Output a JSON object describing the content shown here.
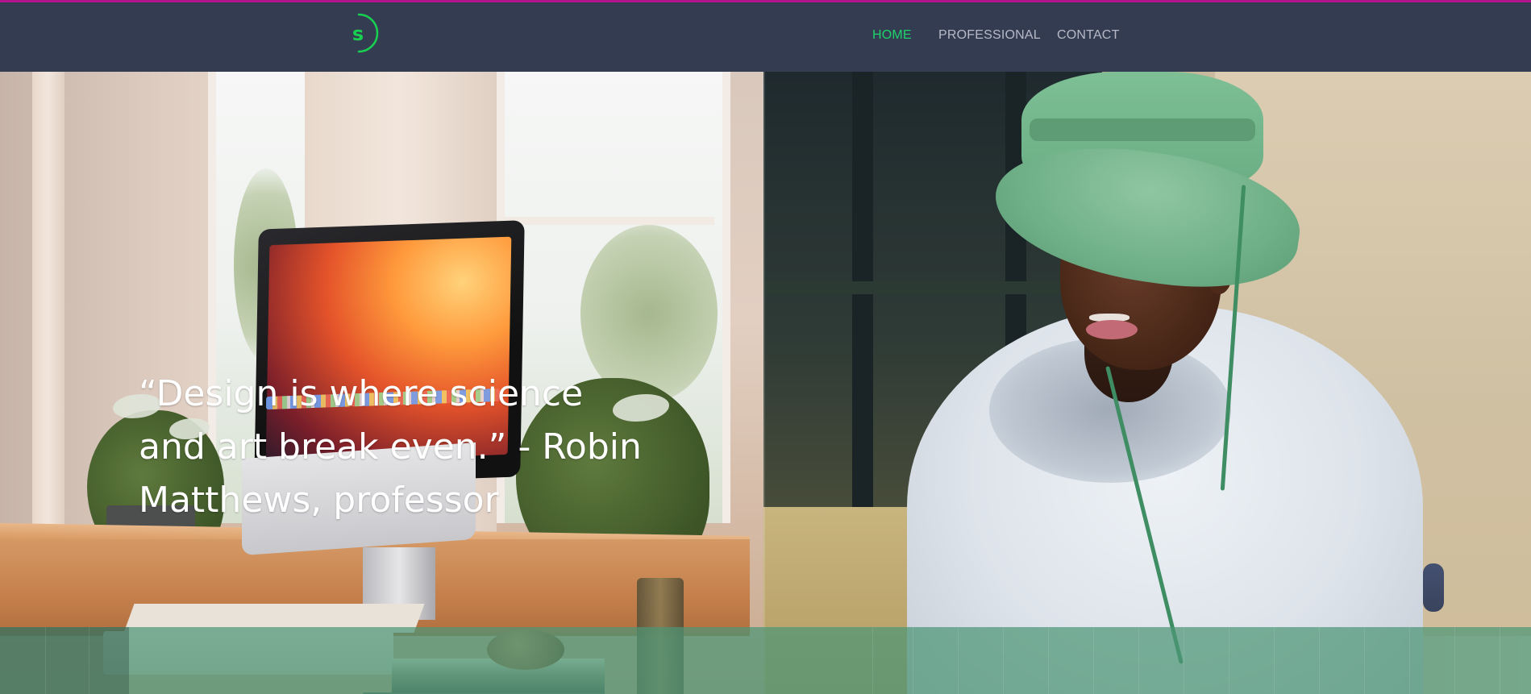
{
  "logo": {
    "letter": "s"
  },
  "nav": {
    "items": [
      {
        "label": "HOME",
        "active": true
      },
      {
        "label": "PROFESSIONAL",
        "active": false
      },
      {
        "label": "CONTACT",
        "active": false
      }
    ]
  },
  "hero": {
    "quote": "“Design is where science\nand art break even.” - Robin\nMatthews, professor"
  },
  "colors": {
    "header_bg": "#343c52",
    "top_accent": "#b0158d",
    "brand_green": "#1fd36b",
    "nav_text": "#b7bac6",
    "overlay_green": "#4c9676"
  }
}
